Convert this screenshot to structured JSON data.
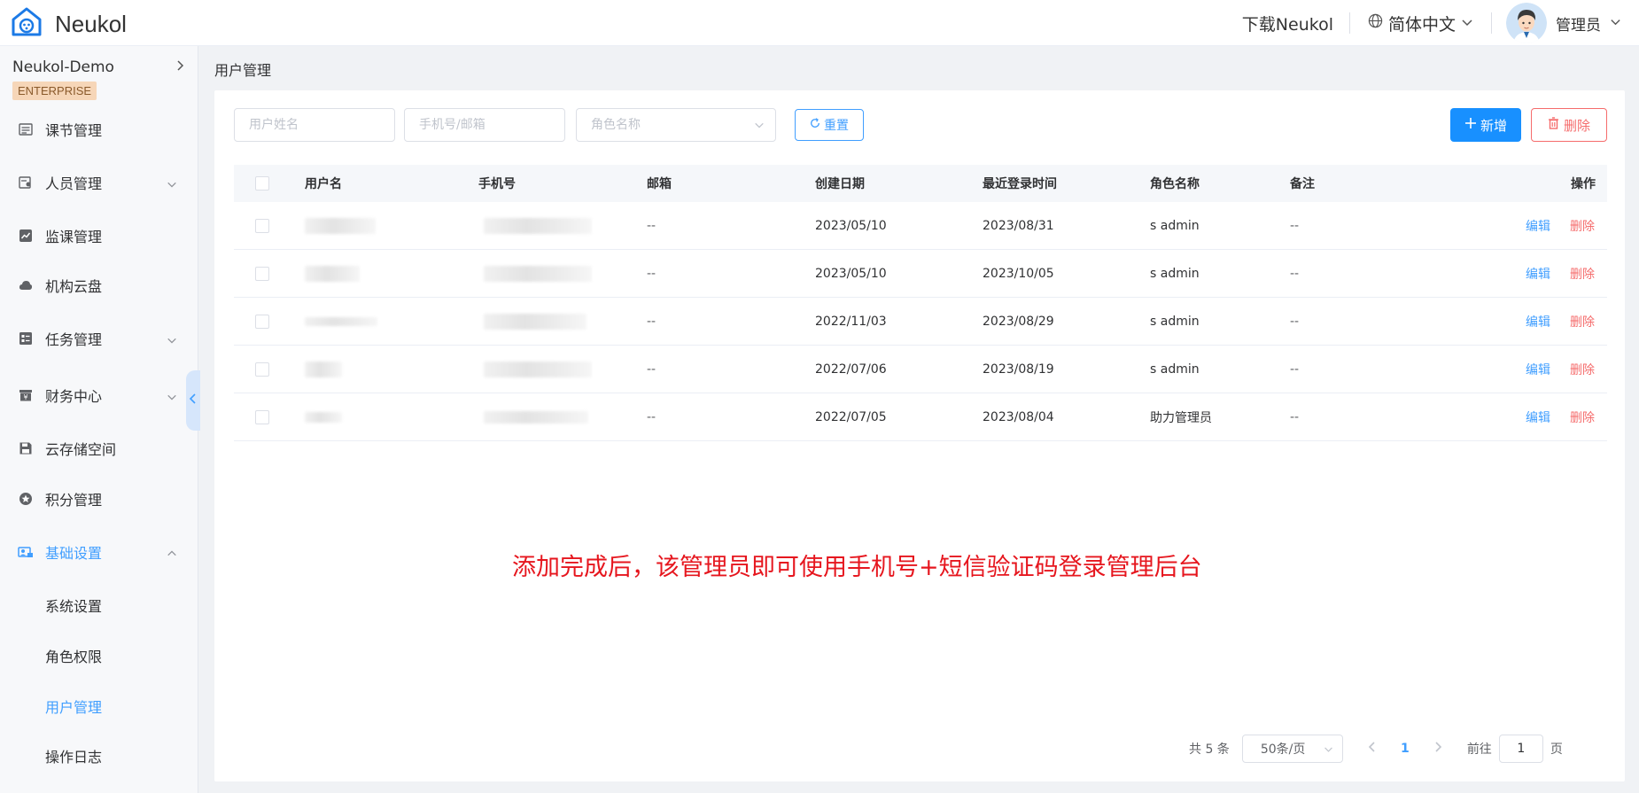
{
  "header": {
    "brand": "Neukol",
    "download": "下载Neukol",
    "language": "简体中文",
    "user": "管理员"
  },
  "sidebar": {
    "org_name": "Neukol-Demo",
    "badge": "ENTERPRISE",
    "items": [
      {
        "label": "课节管理"
      },
      {
        "label": "人员管理"
      },
      {
        "label": "监课管理"
      },
      {
        "label": "机构云盘"
      },
      {
        "label": "任务管理"
      },
      {
        "label": "财务中心"
      },
      {
        "label": "云存储空间"
      },
      {
        "label": "积分管理"
      },
      {
        "label": "基础设置"
      }
    ],
    "sub_items": [
      {
        "label": "系统设置"
      },
      {
        "label": "角色权限"
      },
      {
        "label": "用户管理"
      },
      {
        "label": "操作日志"
      }
    ]
  },
  "breadcrumb": "用户管理",
  "filters": {
    "username_placeholder": "用户姓名",
    "phone_placeholder": "手机号/邮箱",
    "role_placeholder": "角色名称",
    "reset": "重置",
    "add": "新增",
    "delete": "删除"
  },
  "table": {
    "headers": {
      "username": "用户名",
      "phone": "手机号",
      "email": "邮箱",
      "created": "创建日期",
      "last_login": "最近登录时间",
      "role": "角色名称",
      "remark": "备注",
      "ops": "操作"
    },
    "rows": [
      {
        "email": "--",
        "created": "2023/05/10",
        "last_login": "2023/08/31",
        "role": "s admin",
        "remark": "--",
        "edit": "编辑",
        "del": "删除"
      },
      {
        "email": "--",
        "created": "2023/05/10",
        "last_login": "2023/10/05",
        "role": "s admin",
        "remark": "--",
        "edit": "编辑",
        "del": "删除"
      },
      {
        "email": "--",
        "created": "2022/11/03",
        "last_login": "2023/08/29",
        "role": "s admin",
        "remark": "--",
        "edit": "编辑",
        "del": "删除"
      },
      {
        "email": "--",
        "created": "2022/07/06",
        "last_login": "2023/08/19",
        "role": "s admin",
        "remark": "--",
        "edit": "编辑",
        "del": "删除"
      },
      {
        "email": "--",
        "created": "2022/07/05",
        "last_login": "2023/08/04",
        "role": "助力管理员",
        "remark": "--",
        "edit": "编辑",
        "del": "删除"
      }
    ]
  },
  "note": "添加完成后，该管理员即可使用手机号+短信验证码登录管理后台",
  "pagination": {
    "total": "共 5 条",
    "page_size": "50条/页",
    "current": "1",
    "goto_prefix": "前往",
    "goto_value": "1",
    "goto_suffix": "页"
  },
  "colors": {
    "primary": "#409eff",
    "danger": "#f56c6c",
    "note_red": "#e6161e"
  }
}
